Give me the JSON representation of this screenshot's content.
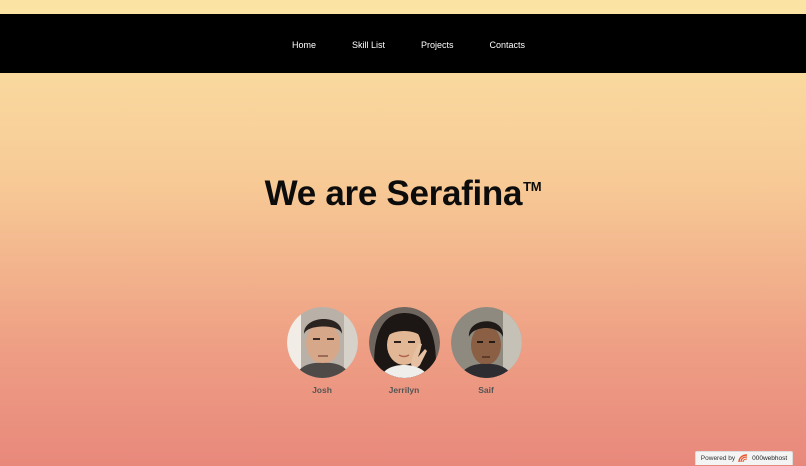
{
  "nav": {
    "items": [
      {
        "label": "Home"
      },
      {
        "label": "Skill List"
      },
      {
        "label": "Projects"
      },
      {
        "label": "Contacts"
      }
    ]
  },
  "hero": {
    "title": "We are Serafina",
    "trademark": "TM"
  },
  "team": [
    {
      "name": "Josh"
    },
    {
      "name": "Jerrilyn"
    },
    {
      "name": "Saif"
    }
  ],
  "footer_badge": {
    "prefix": "Powered by",
    "brand": "000webhost"
  },
  "colors": {
    "navbar_bg": "#000000",
    "gradient_top": "#fbe3a4",
    "gradient_bottom": "#e8887c"
  }
}
